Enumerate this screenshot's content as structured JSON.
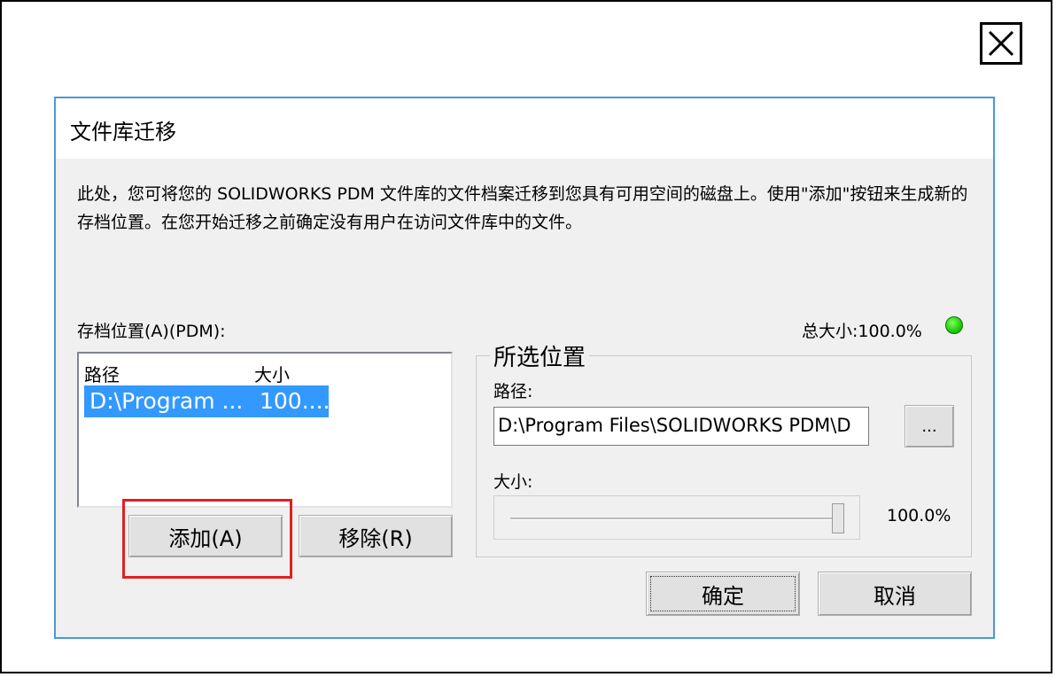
{
  "dialog": {
    "title": "文件库迁移",
    "description": "此处，您可将您的 SOLIDWORKS PDM 文件库的文件档案迁移到您具有可用空间的磁盘上。使用\"添加\"按钮来生成新的存档位置。在您开始迁移之前确定没有用户在访问文件库中的文件。"
  },
  "archive": {
    "label": "存档位置(A)(PDM):",
    "total_size": "总大小:100.0%",
    "status_color": "#11c000",
    "columns": [
      "路径",
      "大小"
    ],
    "rows": [
      {
        "path": "D:\\Program ...",
        "size": "100...."
      }
    ]
  },
  "buttons": {
    "add": "添加(A)",
    "remove": "移除(R)",
    "browse": "...",
    "ok": "确定",
    "cancel": "取消"
  },
  "selected_location": {
    "group_title": "所选位置",
    "path_label": "路径:",
    "path_value": "D:\\Program Files\\SOLIDWORKS PDM\\D",
    "size_label": "大小:",
    "size_value": "100.0%",
    "slider_fraction": 1.0
  },
  "colors": {
    "accent": "#3399ff",
    "highlight": "#e02020",
    "dialog_border": "#4a9ad8"
  },
  "icons": {
    "close": "close-icon"
  }
}
